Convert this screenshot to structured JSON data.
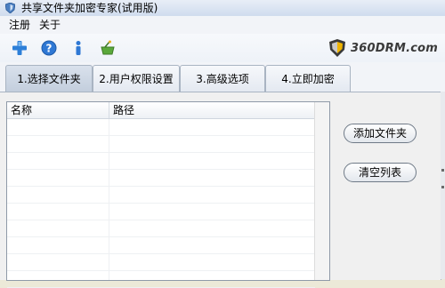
{
  "window": {
    "title": "共享文件夹加密专家(试用版)"
  },
  "menu": {
    "items": [
      "注册",
      "关于"
    ]
  },
  "toolbar": {
    "buttons": [
      "add-icon",
      "help-icon",
      "info-icon",
      "shop-icon"
    ],
    "logo_text": "360DRM.com"
  },
  "tabs": [
    {
      "label": "1.选择文件夹",
      "active": true
    },
    {
      "label": "2.用户权限设置",
      "active": false
    },
    {
      "label": "3.高级选项",
      "active": false
    },
    {
      "label": "4.立即加密",
      "active": false
    }
  ],
  "listview": {
    "columns": [
      "名称",
      "路径"
    ]
  },
  "actions": {
    "add_folder": "添加文件夹",
    "clear_list": "清空列表"
  }
}
